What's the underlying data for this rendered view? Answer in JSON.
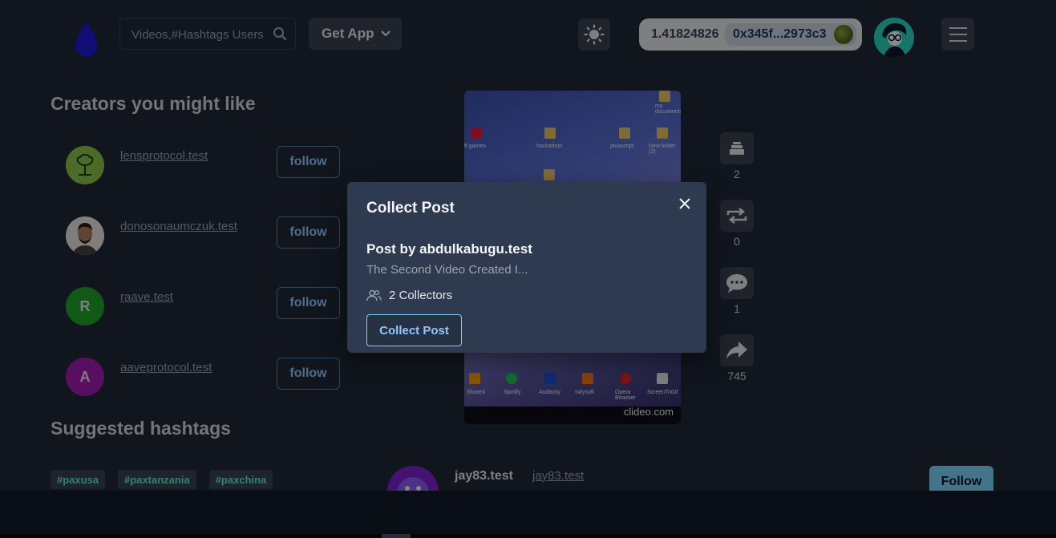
{
  "header": {
    "search_placeholder": "Videos,#Hashtags Users",
    "get_app_label": "Get App",
    "wallet_balance": "1.41824826",
    "wallet_address": "0x345f...2973c3"
  },
  "creators": {
    "heading": "Creators you might like",
    "items": [
      {
        "name": "lensprotocol.test",
        "initial": "",
        "avatar_color": "#84cc16",
        "button": "follow"
      },
      {
        "name": "donosonaumczuk.test",
        "initial": "",
        "avatar_color": "#d6d3d1",
        "button": "follow"
      },
      {
        "name": "raave.test",
        "initial": "R",
        "avatar_color": "#22a22b",
        "button": "follow"
      },
      {
        "name": "aaveprotocol.test",
        "initial": "A",
        "avatar_color": "#a21caf",
        "button": "follow"
      }
    ]
  },
  "hashtags": {
    "heading": "Suggested hashtags",
    "items": [
      "#paxusa",
      "#paxtanzania",
      "#paxchina"
    ]
  },
  "video": {
    "desktop_icons": [
      "ft games",
      "hackathon",
      "javascript",
      "New folder (2)",
      "my documents",
      "ShareX",
      "Spotify",
      "Audacity",
      "Iskysoft",
      "Opera Browser",
      "ScreenToGif"
    ],
    "watermark": "clideo.com"
  },
  "actions": {
    "collect_count": "2",
    "mirror_count": "0",
    "comment_count": "1",
    "share_count": "745"
  },
  "post_author": {
    "display_name": "jay83.test",
    "handle": "jay83.test",
    "follow_label": "Follow"
  },
  "modal": {
    "title": "Collect Post",
    "post_by": "Post by abdulkabugu.test",
    "description": "The Second Video Created I...",
    "collectors": "2 Collectors",
    "button_label": "Collect Post"
  },
  "colors": {
    "page_bg": "#1f2937",
    "modal_bg": "#2d3a4f",
    "accent": "#7dd3fc",
    "hashtag_text": "#5eead4"
  }
}
